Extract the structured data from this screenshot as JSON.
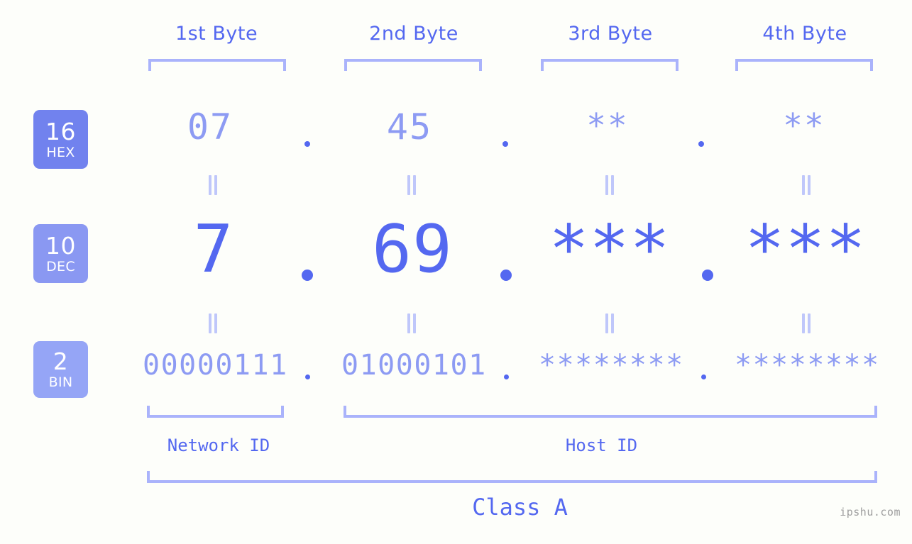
{
  "background_color": "#fdfefa",
  "accent_color": "#5468f0",
  "accent_light_color": "#8d9bf3",
  "bracket_color": "#aab3fb",
  "byte_headers": [
    {
      "label": "1st Byte"
    },
    {
      "label": "2nd Byte"
    },
    {
      "label": "3rd Byte"
    },
    {
      "label": "4th Byte"
    }
  ],
  "bases": [
    {
      "number": "16",
      "name": "HEX",
      "color": "#7182ee"
    },
    {
      "number": "10",
      "name": "DEC",
      "color": "#8a98f2"
    },
    {
      "number": "2",
      "name": "BIN",
      "color": "#95a5f6"
    }
  ],
  "rows": {
    "hex": {
      "values": [
        "07",
        "45",
        "**",
        "**"
      ]
    },
    "dec": {
      "values": [
        "7",
        "69",
        "***",
        "***"
      ]
    },
    "bin": {
      "values": [
        "00000111",
        "01000101",
        "********",
        "********"
      ]
    }
  },
  "separators": {
    "symbol": "."
  },
  "equals_symbol": "=",
  "segments": {
    "network_id": "Network ID",
    "host_id": "Host ID"
  },
  "class_label": "Class A",
  "watermark": "ipshu.com"
}
